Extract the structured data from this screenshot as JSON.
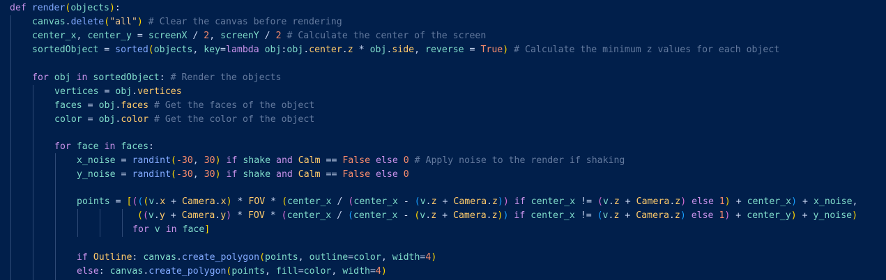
{
  "lines": [
    {
      "text": "def render(objects):"
    },
    {
      "text": "canvas.delete(\"all\") # Clear the canvas before rendering"
    },
    {
      "text": "center_x, center_y = screenX / 2, screenY / 2 # Calculate the center of the screen"
    },
    {
      "text": "sortedObject = sorted(objects, key=lambda obj:obj.center.z * obj.side, reverse = True) # Calculate the minimum z values for each object"
    },
    {
      "text": ""
    },
    {
      "text": "for obj in sortedObject: # Render the objects"
    },
    {
      "text": "vertices = obj.vertices"
    },
    {
      "text": "faces = obj.faces # Get the faces of the object"
    },
    {
      "text": "color = obj.color # Get the color of the object"
    },
    {
      "text": ""
    },
    {
      "text": "for face in faces:"
    },
    {
      "text": "x_noise = randint(-30, 30) if shake and Calm == False else 0 # Apply noise to the render if shaking"
    },
    {
      "text": "y_noise = randint(-30, 30) if shake and Calm == False else 0"
    },
    {
      "text": ""
    },
    {
      "text": "points = [(((v.x + Camera.x) * FOV * (center_x / (center_x - (v.z + Camera.z)) if center_x != (v.z + Camera.z) else 1) + center_x) + x_noise,"
    },
    {
      "text": "((v.y + Camera.y) * FOV * (center_x / (center_x - (v.z + Camera.z)) if center_x != (v.z + Camera.z) else 1) + center_y) + y_noise)"
    },
    {
      "text": "for v in face]"
    },
    {
      "text": ""
    },
    {
      "text": "if Outline: canvas.create_polygon(points, outline=color, width=4)"
    },
    {
      "text": "else: canvas.create_polygon(points, fill=color, width=4)"
    }
  ]
}
